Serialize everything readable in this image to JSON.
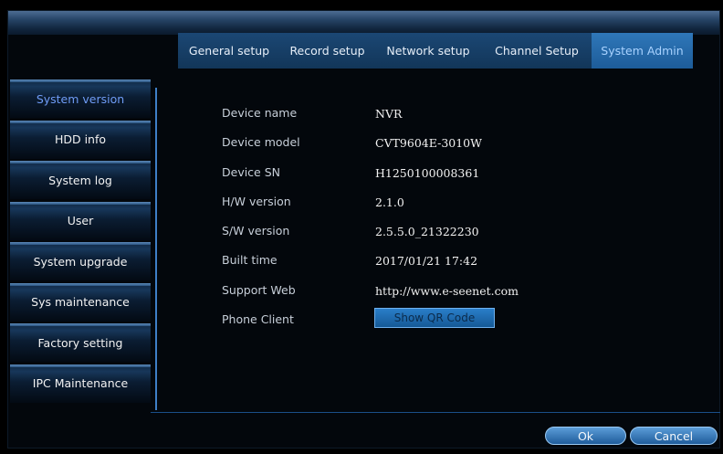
{
  "tabs": [
    "General setup",
    "Record setup",
    "Network setup",
    "Channel Setup",
    "System Admin"
  ],
  "active_tab": "System Admin",
  "sidebar": {
    "items": [
      "System version",
      "HDD info",
      "System log",
      "User",
      "System upgrade",
      "Sys maintenance",
      "Factory setting",
      "IPC Maintenance"
    ],
    "active": "System version"
  },
  "info": {
    "device_name": {
      "label": "Device name",
      "value": "NVR"
    },
    "device_model": {
      "label": "Device model",
      "value": "CVT9604E-3010W"
    },
    "device_sn": {
      "label": "Device SN",
      "value": "H1250100008361"
    },
    "hw_version": {
      "label": "H/W version",
      "value": "2.1.0"
    },
    "sw_version": {
      "label": "S/W version",
      "value": "2.5.5.0_21322230"
    },
    "built_time": {
      "label": "Built time",
      "value": "2017/01/21 17:42"
    },
    "support_web": {
      "label": "Support Web",
      "value": "http://www.e-seenet.com"
    },
    "phone_client": {
      "label": "Phone Client",
      "button": "Show QR Code"
    }
  },
  "buttons": {
    "ok": "Ok",
    "cancel": "Cancel"
  }
}
